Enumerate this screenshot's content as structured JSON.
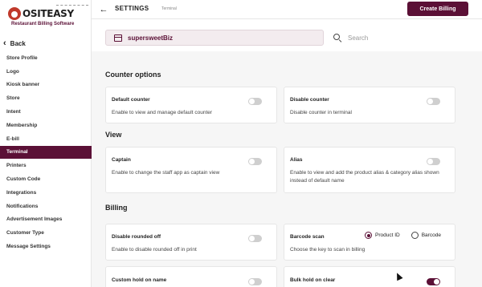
{
  "app": {
    "logo_text": "OSITEASY",
    "logo_tagline": "Restaurant Billing Software"
  },
  "sidebar": {
    "back_label": "Back",
    "items": [
      {
        "label": "Store Profile"
      },
      {
        "label": "Logo"
      },
      {
        "label": "Kiosk banner"
      },
      {
        "label": "Store"
      },
      {
        "label": "Intent"
      },
      {
        "label": "Membership"
      },
      {
        "label": "E-bill"
      },
      {
        "label": "Terminal",
        "active": true
      },
      {
        "label": "Printers"
      },
      {
        "label": "Custom Code"
      },
      {
        "label": "Integrations"
      },
      {
        "label": "Notifications"
      },
      {
        "label": "Advertisement Images"
      },
      {
        "label": "Customer Type"
      },
      {
        "label": "Message Settings"
      }
    ]
  },
  "header": {
    "title": "SETTINGS",
    "subtitle": "Terminal",
    "create_billing_label": "Create Billing"
  },
  "store": {
    "name": "supersweetBiz"
  },
  "search": {
    "placeholder": "Search"
  },
  "sections": {
    "counter_options": {
      "title": "Counter options",
      "cards": [
        {
          "title": "Default counter",
          "desc": "Enable to view and manage default counter",
          "enabled": false
        },
        {
          "title": "Disable counter",
          "desc": "Disable counter in terminal",
          "enabled": false
        }
      ]
    },
    "view": {
      "title": "View",
      "cards": [
        {
          "title": "Captain",
          "desc": "Enable to change the staff app as captain view",
          "enabled": false
        },
        {
          "title": "Alias",
          "desc": "Enable to view and add the product alias & category alias shown instead of default name",
          "enabled": false
        }
      ]
    },
    "billing": {
      "title": "Billing",
      "cards": [
        {
          "title": "Disable rounded off",
          "desc": "Enable to disable rounded off in print",
          "enabled": false
        },
        {
          "title": "Barcode scan",
          "desc": "Choose the key to scan in billing",
          "options": [
            "Product ID",
            "Barcode"
          ],
          "selected": "Product ID"
        },
        {
          "title": "Custom hold on name",
          "desc": "",
          "enabled": false
        },
        {
          "title": "Bulk hold on clear",
          "desc": "",
          "enabled": true
        }
      ]
    }
  },
  "colors": {
    "brand": "#5b1036",
    "toggle_off": "#cfcfcf"
  }
}
